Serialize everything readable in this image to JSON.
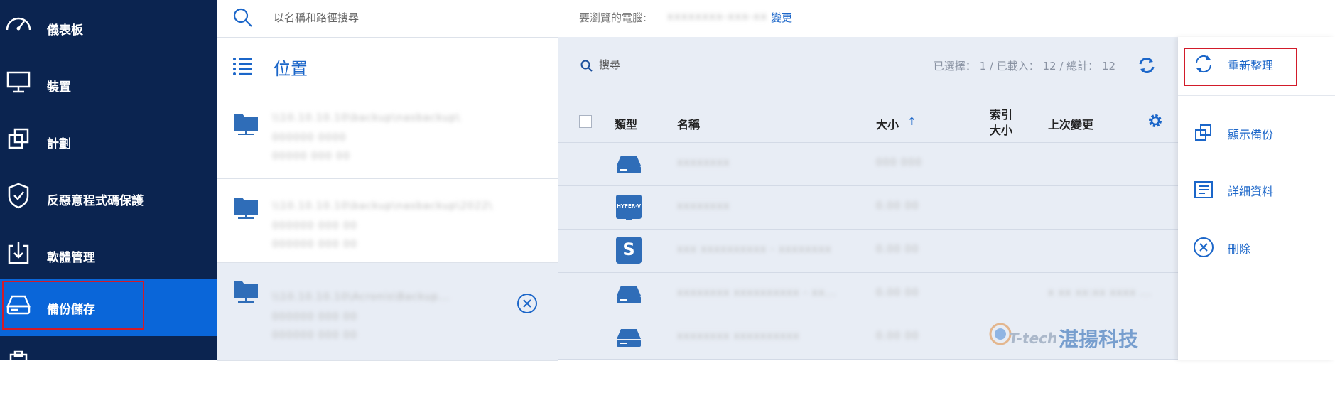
{
  "sidebar": {
    "items": [
      {
        "label": "儀表板",
        "icon": "dashboard-icon"
      },
      {
        "label": "裝置",
        "icon": "monitor-icon"
      },
      {
        "label": "計劃",
        "icon": "plans-icon"
      },
      {
        "label": "反惡意程式碼保護",
        "icon": "shield-icon"
      },
      {
        "label": "軟體管理",
        "icon": "download-box-icon"
      },
      {
        "label": "備份儲存",
        "icon": "storage-drive-icon"
      },
      {
        "label": "報",
        "icon": "clipboard-icon"
      }
    ],
    "active_index": 5
  },
  "locations": {
    "search_placeholder": "以名稱和路徑搜尋",
    "title": "位置",
    "items": [
      {
        "path": "\\\\10.10.10.10\\backup\\nasbackup\\",
        "line2": "000000 0000",
        "line3": "00000 000 00"
      },
      {
        "path": "\\\\10.10.10.10\\backup\\nasbackup\\2022\\",
        "line2": "000000 000 00",
        "line3": "000000 000 00"
      },
      {
        "path": "\\\\10.10.10.10\\Acronis\\Backup...",
        "line2": "000000 000 00",
        "line3": "000000 000 00"
      }
    ]
  },
  "computer_bar": {
    "label": "要瀏覽的電腦:",
    "value": "xxxxxxxx-xxx-xx",
    "change_link": "變更"
  },
  "table": {
    "search_label": "搜尋",
    "counts": "已選擇： 1 / 已載入： 12 / 總計： 12",
    "headers": {
      "type": "類型",
      "name": "名稱",
      "size": "大小",
      "index_size_1": "索引",
      "index_size_2": "大小",
      "last_change": "上次變更"
    },
    "rows": [
      {
        "type_icon": "drive-icon",
        "name": "xxxxxxxx",
        "size": "000 000",
        "last_change": ""
      },
      {
        "type_icon": "hyperv-icon",
        "hyperv_label": "HYPER-V",
        "name": "xxxxxxxx",
        "size": "0.00 00",
        "last_change": ""
      },
      {
        "type_icon": "sql-icon",
        "sql_letter": "S",
        "name": "xxx xxxxxxxxxx - xxxxxxxx",
        "size": "0.00 00",
        "last_change": ""
      },
      {
        "type_icon": "drive-icon",
        "name": "xxxxxxxx xxxxxxxxxx - xx...",
        "size": "0.00 00",
        "last_change": "x xx xx:xx xxxx ..."
      },
      {
        "type_icon": "drive-icon",
        "name": "xxxxxxxx xxxxxxxxxx",
        "size": "0.00 00",
        "last_change": ""
      }
    ]
  },
  "actions": [
    {
      "label": "重新整理",
      "icon": "refresh-icon"
    },
    {
      "label": "顯示備份",
      "icon": "copy-icon"
    },
    {
      "label": "詳細資料",
      "icon": "details-icon"
    },
    {
      "label": "刪除",
      "icon": "delete-circle-icon"
    }
  ],
  "watermark": {
    "brand": "T-tech",
    "text": "湛揚科技"
  },
  "colors": {
    "sidebar": "#0b2450",
    "active": "#0a66d9",
    "accent": "#1b66c9",
    "highlight": "#d21b2a"
  }
}
